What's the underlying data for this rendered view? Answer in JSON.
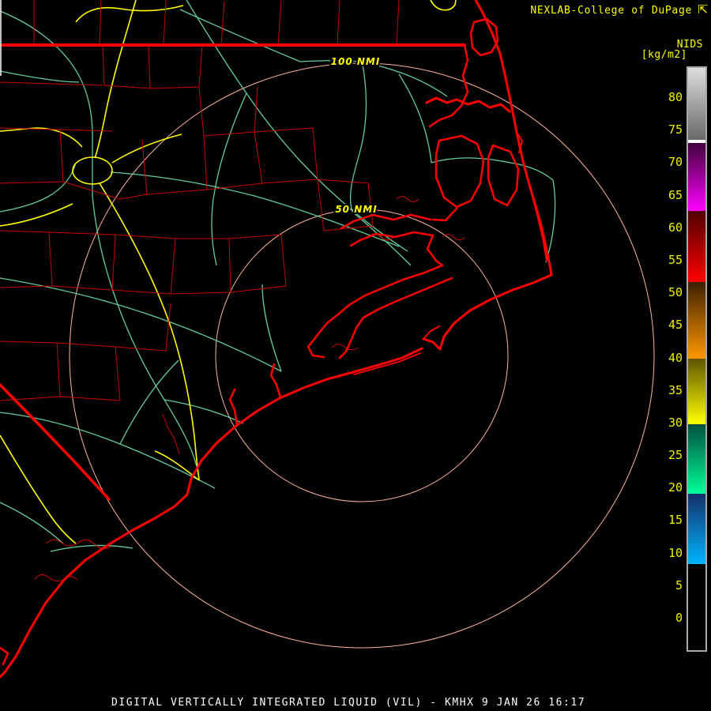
{
  "header": {
    "title": "NEXLAB-College of DuPage",
    "logo_glyph": "⇱"
  },
  "colorbar": {
    "title": "NIDS",
    "units_label": "[kg/m2]",
    "ticks": [
      80,
      75,
      70,
      65,
      60,
      55,
      50,
      45,
      40,
      35,
      30,
      25,
      20,
      15,
      10,
      5,
      0
    ],
    "segments": [
      {
        "hi": 84.5,
        "lo": 73.5,
        "top": "#dedede",
        "bottom": "#686868"
      },
      {
        "hi": 73.5,
        "lo": 72.9,
        "top": "#ffffff",
        "bottom": "#ffffff"
      },
      {
        "hi": 72.9,
        "lo": 62.5,
        "top": "#40003a",
        "bottom": "#ff00ff"
      },
      {
        "hi": 62.5,
        "lo": 51.6,
        "top": "#500000",
        "bottom": "#ff0000"
      },
      {
        "hi": 51.6,
        "lo": 39.8,
        "top": "#3c2000",
        "bottom": "#ff9600"
      },
      {
        "hi": 39.8,
        "lo": 29.8,
        "top": "#5f5500",
        "bottom": "#ffff00"
      },
      {
        "hi": 29.8,
        "lo": 19.1,
        "top": "#00503f",
        "bottom": "#00ff96"
      },
      {
        "hi": 19.1,
        "lo": 8.2,
        "top": "#143069",
        "bottom": "#00b4ff"
      },
      {
        "hi": 8.2,
        "lo": -5.0,
        "top": "#000000",
        "bottom": "#000000"
      }
    ]
  },
  "rings": {
    "outer_label": "100 NMI",
    "inner_label": "50 NMI"
  },
  "caption": {
    "text": "DIGITAL VERTICALLY INTEGRATED LIQUID (VIL) - KMHX 9 JAN 26 16:17"
  },
  "palette": {
    "background": "#000000",
    "coast_red": "#ff0000",
    "county_red": "#cc0000",
    "road_green": "#66cc99",
    "road_yellow": "#ffff00",
    "ring_peach": "#ffb49b",
    "label_yellow": "#f0f000",
    "text_yellow": "#ffff00",
    "caption_white": "#ffffff"
  }
}
